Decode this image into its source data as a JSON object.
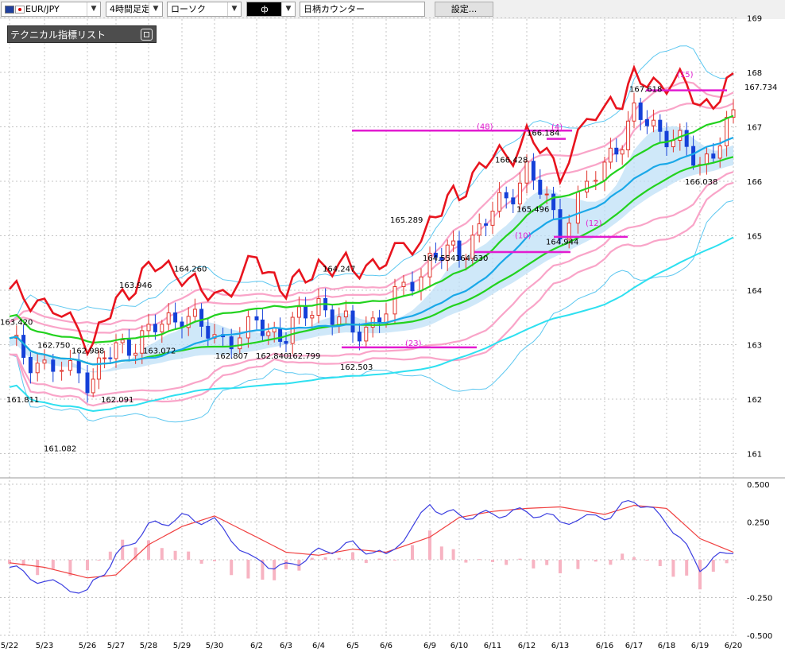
{
  "toolbar": {
    "symbol": "EUR/JPY",
    "timeframe": "4時間足定",
    "chart_style": "ローソク",
    "color_swatch": "ф",
    "counter": "日柄カウンター",
    "settings_label": "設定..."
  },
  "indicator_panel": {
    "title": "テクニカル指標リスト"
  },
  "price_axis": {
    "labels": [
      "169",
      "168",
      "167",
      "166",
      "165",
      "164",
      "163",
      "162",
      "161"
    ],
    "current_price": "167.734"
  },
  "macd_axis": {
    "labels": [
      "0.500",
      "0.250",
      "-0.250",
      "-0.500"
    ]
  },
  "date_axis": {
    "labels": [
      "5/22",
      "5/23",
      "5/26",
      "5/27",
      "5/28",
      "5/29",
      "5/30",
      "6/2",
      "6/3",
      "6/4",
      "6/5",
      "6/6",
      "6/9",
      "6/10",
      "6/11",
      "6/12",
      "6/13",
      "6/16",
      "6/17",
      "6/18",
      "6/19",
      "6/20"
    ]
  },
  "price_annotations": [
    "163.420",
    "162.750",
    "162.988",
    "161.811",
    "161.082",
    "162.091",
    "163.946",
    "163.072",
    "164.260",
    "162.807",
    "162.840",
    "162.799",
    "164.247",
    "162.503",
    "165.289",
    "164.554",
    "164.630",
    "166.428",
    "166.184",
    "165.496",
    "164.944",
    "167.618",
    "166.038"
  ],
  "count_labels": [
    "(48)",
    "(23)",
    "(10)",
    "(12)",
    "(15)",
    "(4)"
  ],
  "colors": {
    "up": "#e0342c",
    "down": "#1540d8",
    "cloud": "#bfe0f7",
    "red_line": "#e8141e",
    "green": "#22d21e",
    "blue_line": "#1aa8e8",
    "pink": "#f9a4c8",
    "magenta": "#e21bd0",
    "macd": "#3a3de0",
    "signal": "#f04040",
    "hist": "#f7b3c2"
  },
  "chart_data": [
    {
      "type": "line",
      "symbol": "EUR/JPY",
      "ylim": [
        160.4,
        169.0
      ],
      "x": [
        "5/22",
        "5/23",
        "5/26",
        "5/27",
        "5/28",
        "5/29",
        "5/30",
        "6/2",
        "6/3",
        "6/4",
        "6/5",
        "6/6",
        "6/9",
        "6/10",
        "6/11",
        "6/12",
        "6/13",
        "6/16",
        "6/17",
        "6/18",
        "6/19",
        "6/20"
      ],
      "series": [
        {
          "values": [
            163.0,
            162.6,
            162.4,
            162.9,
            163.2,
            163.6,
            163.1,
            163.3,
            163.2,
            163.8,
            163.2,
            163.6,
            164.6,
            164.7,
            165.4,
            166.2,
            165.2,
            166.3,
            167.2,
            166.9,
            166.3,
            167.1
          ]
        }
      ]
    },
    {
      "type": "bar",
      "ylim": [
        -0.5,
        0.5
      ],
      "x": [
        "5/22",
        "5/23",
        "5/26",
        "5/27",
        "5/28",
        "5/29",
        "5/30",
        "6/2",
        "6/3",
        "6/4",
        "6/5",
        "6/6",
        "6/9",
        "6/10",
        "6/11",
        "6/12",
        "6/13",
        "6/16",
        "6/17",
        "6/18",
        "6/19",
        "6/20"
      ],
      "series": [
        {
          "values": [
            -0.05,
            -0.15,
            -0.21,
            0.02,
            0.22,
            0.28,
            0.25,
            -0.02,
            -0.05,
            0.05,
            0.1,
            0.02,
            0.35,
            0.29,
            0.3,
            0.32,
            0.26,
            0.28,
            0.4,
            0.26,
            -0.05,
            0.07
          ]
        },
        {
          "values": [
            -0.02,
            -0.05,
            -0.12,
            -0.1,
            0.1,
            0.22,
            0.29,
            0.15,
            0.05,
            0.03,
            0.07,
            0.05,
            0.15,
            0.28,
            0.32,
            0.34,
            0.35,
            0.3,
            0.36,
            0.34,
            0.14,
            0.05
          ]
        }
      ]
    }
  ]
}
